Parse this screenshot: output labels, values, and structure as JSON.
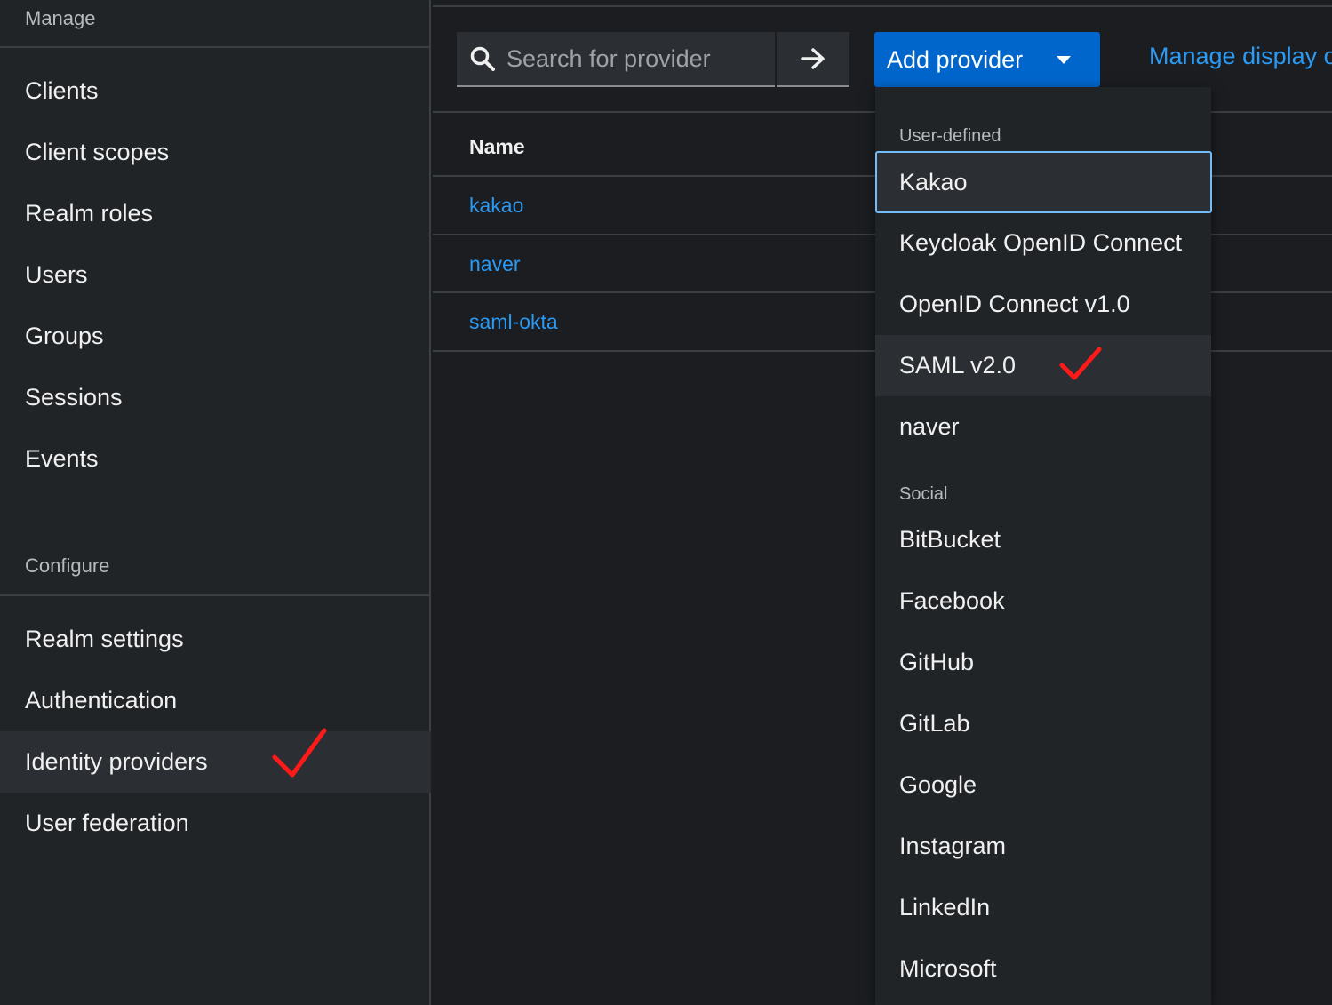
{
  "sidebar": {
    "manage_label": "Manage",
    "configure_label": "Configure",
    "manage_items": [
      "Clients",
      "Client scopes",
      "Realm roles",
      "Users",
      "Groups",
      "Sessions",
      "Events"
    ],
    "configure_items": [
      "Realm settings",
      "Authentication",
      "Identity providers",
      "User federation"
    ],
    "active_item": "Identity providers"
  },
  "toolbar": {
    "search_placeholder": "Search for provider",
    "add_provider_label": "Add provider",
    "manage_display_label": "Manage display o"
  },
  "table": {
    "column_name": "Name",
    "rows": [
      "kakao",
      "naver",
      "saml-okta"
    ]
  },
  "dropdown": {
    "user_defined_label": "User-defined",
    "user_defined_items": [
      "Kakao",
      "Keycloak OpenID Connect",
      "OpenID Connect v1.0",
      "SAML v2.0",
      "naver"
    ],
    "social_label": "Social",
    "social_items": [
      "BitBucket",
      "Facebook",
      "GitHub",
      "GitLab",
      "Google",
      "Instagram",
      "LinkedIn",
      "Microsoft"
    ],
    "focused_item": "Kakao",
    "hovered_item": "SAML v2.0"
  },
  "colors": {
    "accent": "#0066cc",
    "link": "#2b9af3",
    "annotation": "#ff1a1a"
  }
}
